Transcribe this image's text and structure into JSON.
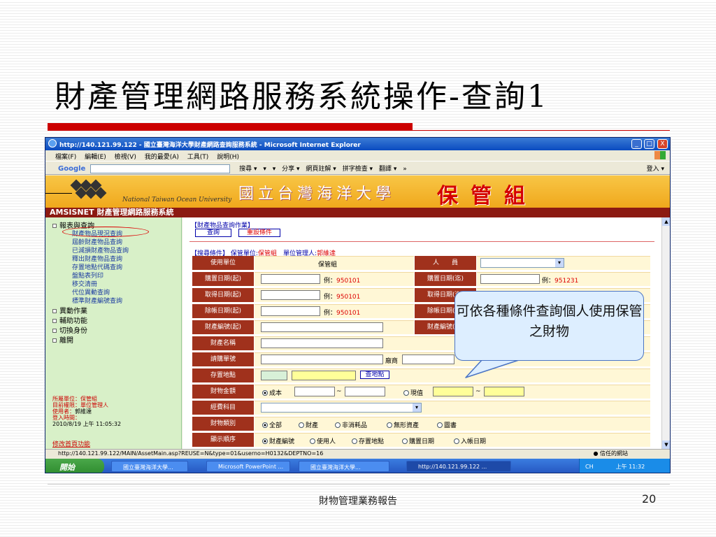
{
  "slide": {
    "title": "財產管理網路服務系統操作-查詢1",
    "footer": "財物管理業務報告",
    "page_number": "20",
    "accent_color": "#cc0000",
    "callout_text": "可依各種條件查詢個人使用保管之財物"
  },
  "browser": {
    "title": "http://140.121.99.122 - 國立臺灣海洋大學財產網路查詢服務系統 - Microsoft Internet Explorer",
    "window_buttons": [
      "_",
      "□",
      "X"
    ],
    "menu": [
      "檔案(F)",
      "編輯(E)",
      "檢視(V)",
      "我的最愛(A)",
      "工具(T)",
      "說明(H)"
    ],
    "google_label": "Google",
    "google_tools": [
      "搜尋 ▾",
      "▾",
      "▾",
      "分享 ▾",
      "網頁註解 ▾",
      "拼字檢查 ▾",
      "翻譯 ▾",
      "»"
    ],
    "google_right": "登入 ▾",
    "status_url": "http://140.121.99.122/MAIN/AssetMain.asp?REUSE=N&type=01&userno=H0132&DEPTNO=16",
    "status_zone": "信任的網站"
  },
  "banner": {
    "university_en": "National Taiwan Ocean University",
    "university_zh": "國立台灣海洋大學",
    "unit": "保管組",
    "system_bar": "AMSISNET 財產管理網路服務系統",
    "brand_color": "#8c1a12"
  },
  "sidebar": {
    "items": [
      {
        "label": "報表與查詢",
        "level": "top"
      },
      {
        "label": "財產物品現況查詢",
        "level": "sub",
        "highlighted": true
      },
      {
        "label": "屆齡財產物品查詢",
        "level": "sub"
      },
      {
        "label": "已減損財產物品查詢",
        "level": "sub"
      },
      {
        "label": "釋出財產物品查詢",
        "level": "sub"
      },
      {
        "label": "存置地點代碼查詢",
        "level": "sub"
      },
      {
        "label": "盤點表列印",
        "level": "sub"
      },
      {
        "label": "移交清冊",
        "level": "sub"
      },
      {
        "label": "代位異動查詢",
        "level": "sub"
      },
      {
        "label": "標準財產編號查詢",
        "level": "sub"
      },
      {
        "label": "異動作業",
        "level": "top"
      },
      {
        "label": "輔助功能",
        "level": "top"
      },
      {
        "label": "切換身份",
        "level": "top"
      },
      {
        "label": "離開",
        "level": "top"
      }
    ],
    "info_lines": [
      {
        "key": "所屬單位：",
        "value": "保管組"
      },
      {
        "key": "目前權限：",
        "value": "單位管理人"
      },
      {
        "key": "使用者：",
        "value": "郭維達"
      },
      {
        "key": "登入時間：",
        "value": ""
      }
    ],
    "login_time": "2010/8/19 上午 11:05:32",
    "change_page_link": "修改首頁功能"
  },
  "form": {
    "section_label": "【財產物品查詢作業】",
    "query_button": "查詢",
    "reset_button": "重設條件",
    "criteria_label": "【搜尋條件】",
    "criteria_unit_key": "保管單位:",
    "criteria_unit": "保管組",
    "criteria_manager_key": "單位管理人:",
    "criteria_manager": "郭維達",
    "rows": {
      "unit_label": "使用單位",
      "unit_value": "保管組",
      "person_label": "人　　員",
      "buy_start_label": "購置日期(起)",
      "buy_end_label": "購置日期(迄)",
      "get_start_label": "取得日期(起)",
      "get_end_label": "取得日期(迄)",
      "del_start_label": "除帳日期(起)",
      "del_end_label": "除帳日期(迄)",
      "no_start_label": "財產編號(起)",
      "no_end_label": "財產編號(迄)",
      "name_label": "財產名稱",
      "req_label": "請購單號",
      "vendor_label": "廠商",
      "place_label": "存置地點",
      "place_button": "查地點",
      "amount_label": "財物金額",
      "amount_cost": "成本",
      "amount_current": "現值",
      "tilde": "~",
      "fund_label": "經費科目",
      "kind_label": "財物類別",
      "kind_options": [
        "全部",
        "財產",
        "非消耗品",
        "無形資產",
        "圖書"
      ],
      "order_label": "顯示順序",
      "order_options": [
        "財產編號",
        "使用人",
        "存置地點",
        "購置日期",
        "入帳日期"
      ]
    },
    "example_prefix": "例：",
    "example_start": "950101",
    "example_end": "951231"
  },
  "taskbar": {
    "start": "開始",
    "tasks": [
      "國立臺灣海洋大學...",
      "Microsoft PowerPoint ...",
      "國立臺灣海洋大學...",
      "http://140.121.99.122 ..."
    ],
    "tray_text": "CH",
    "clock": "上午 11:32"
  }
}
